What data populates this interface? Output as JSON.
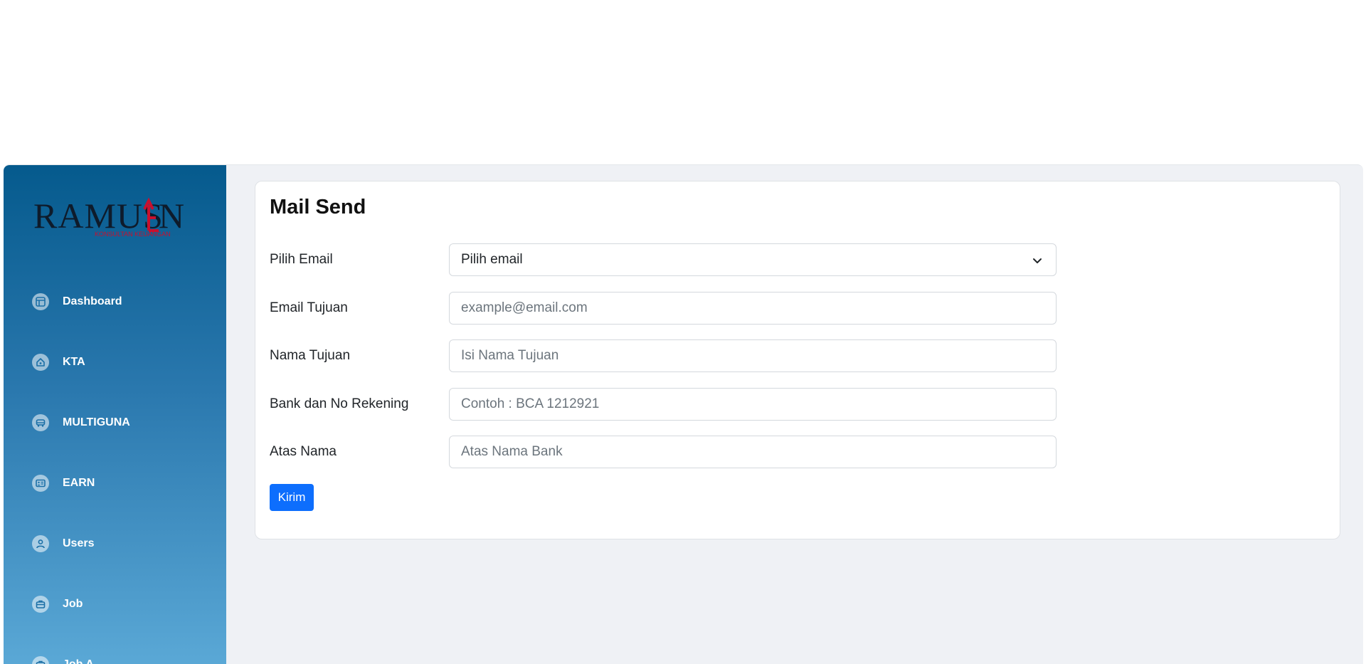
{
  "sidebar": {
    "logo_text": "RAMUSEN",
    "logo_tagline": "Konsultan Keuangan",
    "items": [
      {
        "label": "Dashboard",
        "icon": "dashboard-icon"
      },
      {
        "label": "KTA",
        "icon": "home-icon"
      },
      {
        "label": "MULTIGUNA",
        "icon": "car-icon"
      },
      {
        "label": "EARN",
        "icon": "id-card-icon"
      },
      {
        "label": "Users",
        "icon": "user-icon"
      },
      {
        "label": "Job",
        "icon": "briefcase-icon"
      },
      {
        "label": "Job A...",
        "icon": "briefcase-icon"
      }
    ]
  },
  "main": {
    "title": "Mail Send",
    "form": {
      "pilih_email": {
        "label": "Pilih Email",
        "value": "Pilih email"
      },
      "email_tujuan": {
        "label": "Email Tujuan",
        "placeholder": "example@email.com",
        "value": ""
      },
      "nama_tujuan": {
        "label": "Nama Tujuan",
        "placeholder": "Isi Nama Tujuan",
        "value": ""
      },
      "bank": {
        "label": "Bank dan No Rekening",
        "placeholder": "Contoh : BCA 1212921",
        "value": ""
      },
      "atas_nama": {
        "label": "Atas Nama",
        "placeholder": "Atas Nama Bank",
        "value": ""
      },
      "submit_label": "Kirim"
    }
  },
  "colors": {
    "sidebar_top": "#055a8d",
    "sidebar_bottom": "#5aa8d6",
    "primary_button": "#0d6efd",
    "background": "#eff1f5",
    "logo_red": "#c8102e"
  }
}
